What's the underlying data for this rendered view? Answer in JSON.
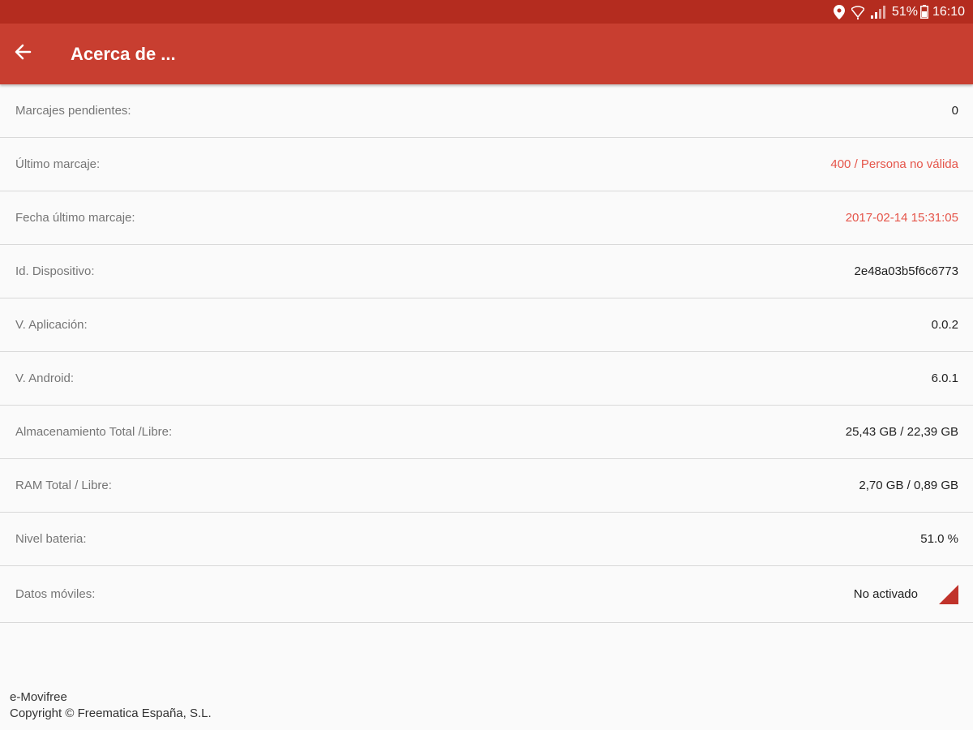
{
  "status_bar": {
    "battery": "51%",
    "time": "16:10",
    "icons": [
      "location-icon",
      "wifi-icon",
      "signal-icon",
      "battery-icon"
    ]
  },
  "app_bar": {
    "title": "Acerca de ...",
    "back_icon": "arrow-back-icon"
  },
  "colors": {
    "status_bar": "#b42c1f",
    "app_bar": "#c83e30",
    "alert_text": "#e5554a"
  },
  "info": {
    "rows": [
      {
        "label": "Marcajes pendientes:",
        "value": "0"
      },
      {
        "label": "Último marcaje:",
        "value": "400 / Persona no válida"
      },
      {
        "label": "Fecha último marcaje:",
        "value": "2017-02-14 15:31:05"
      },
      {
        "label": "Id. Dispositivo:",
        "value": "2e48a03b5f6c6773"
      },
      {
        "label": "V. Aplicación:",
        "value": "0.0.2"
      },
      {
        "label": "V. Android:",
        "value": "6.0.1"
      },
      {
        "label": "Almacenamiento Total /Libre:",
        "value": "25,43 GB / 22,39 GB"
      },
      {
        "label": "RAM Total / Libre:",
        "value": "2,70 GB / 0,89 GB"
      },
      {
        "label": "Nivel bateria:",
        "value": "51.0 %"
      },
      {
        "label": "Datos móviles:",
        "value": "No activado"
      }
    ]
  },
  "footer": {
    "app_name": "e-Movifree",
    "copyright": "Copyright © Freematica España, S.L."
  }
}
